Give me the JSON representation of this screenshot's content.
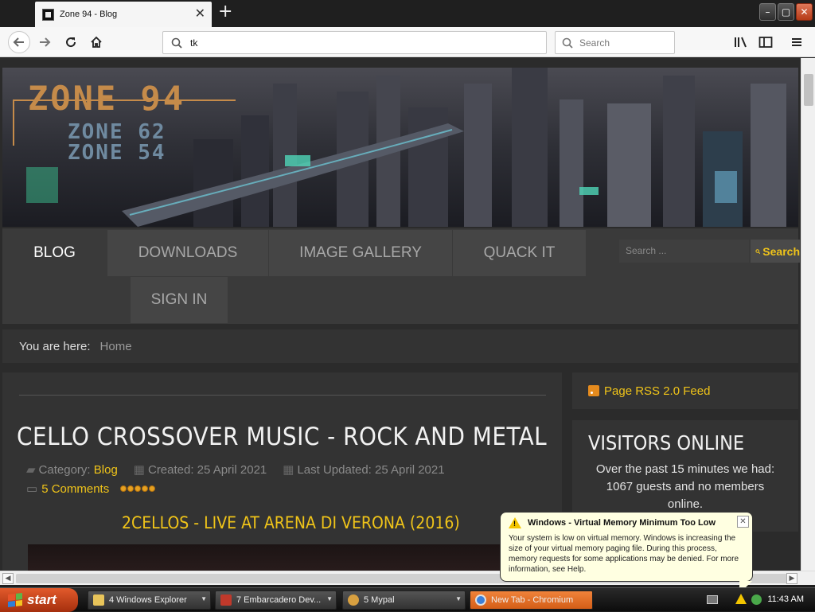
{
  "browser": {
    "tab_title": "Zone 94 - Blog",
    "new_tab_glyph": "+",
    "url_text": "tk",
    "search_placeholder": "Search"
  },
  "site": {
    "logo_main": "ZONE 94",
    "logo_sub1": "ZONE 62",
    "logo_sub2": "ZONE 54",
    "menu": [
      "BLOG",
      "DOWNLOADS",
      "IMAGE GALLERY",
      "QUACK IT",
      "SIGN IN"
    ],
    "search_placeholder": "Search ...",
    "search_button": "Search",
    "breadcrumb_label": "You are here:",
    "breadcrumb_value": "Home"
  },
  "article": {
    "title": "CELLO CROSSOVER MUSIC - ROCK AND METAL",
    "category_label": "Category:",
    "category_value": "Blog",
    "created": "Created: 25 April 2021",
    "updated": "Last Updated: 25 April 2021",
    "comments": "5 Comments",
    "rating_stars": 5,
    "video_title": "2CELLOS - LIVE AT ARENA DI VERONA (2016)"
  },
  "sidebar": {
    "rss_label": "Page RSS 2.0 Feed",
    "visitors_title": "VISITORS ONLINE",
    "visitors_text": "Over the past 15 minutes we had: 1067 guests and no members online."
  },
  "notification": {
    "title": "Windows - Virtual Memory Minimum Too Low",
    "body": "Your system is low on virtual memory. Windows is increasing the size of your virtual memory paging file. During this process, memory requests for some applications may be denied. For more information, see Help."
  },
  "taskbar": {
    "start_label": "start",
    "tasks": [
      "4 Windows Explorer",
      "7 Embarcadero Dev...",
      "5 Mypal",
      "New Tab - Chromium"
    ],
    "clock": "11:43 AM"
  },
  "colors": {
    "accent": "#f0c419",
    "logo_orange": "#c58b4a",
    "page_bg": "#2b2b2b"
  }
}
